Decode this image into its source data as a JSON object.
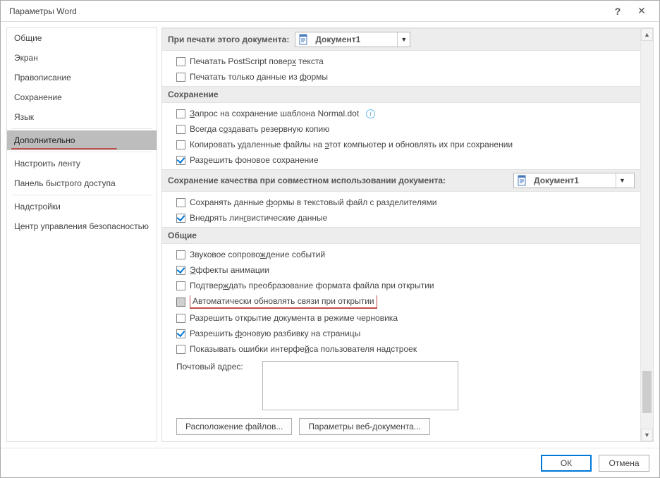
{
  "title": "Параметры Word",
  "titlebar": {
    "help": "?",
    "close": "✕"
  },
  "nav": {
    "items": [
      {
        "label": "Общие"
      },
      {
        "label": "Экран"
      },
      {
        "label": "Правописание"
      },
      {
        "label": "Сохранение"
      },
      {
        "label": "Язык"
      },
      {
        "label": "Дополнительно",
        "selected": true,
        "underline": true
      },
      {
        "label": "Настроить ленту"
      },
      {
        "label": "Панель быстрого доступа"
      },
      {
        "label": "Надстройки"
      },
      {
        "label": "Центр управления безопасностью"
      }
    ]
  },
  "sections": {
    "printDoc": {
      "title": "При печати этого документа:",
      "dropdown": "Документ1",
      "options": [
        {
          "label": "Печатать PostScript поверх текста",
          "checked": false
        },
        {
          "label": "Печатать только данные из формы",
          "checked": false
        }
      ]
    },
    "save": {
      "title": "Сохранение",
      "options": [
        {
          "label": "Запрос на сохранение шаблона Normal.dot",
          "checked": false,
          "info": true
        },
        {
          "label": "Всегда создавать резервную копию",
          "checked": false
        },
        {
          "label": "Копировать удаленные файлы на этот компьютер и обновлять их при сохранении",
          "checked": false
        },
        {
          "label": "Разрешить фоновое сохранение",
          "checked": true
        }
      ]
    },
    "quality": {
      "title": "Сохранение качества при совместном использовании документа:",
      "dropdown": "Документ1",
      "options": [
        {
          "label": "Сохранять данные формы в текстовый файл с разделителями",
          "checked": false
        },
        {
          "label": "Внедрять лингвистические данные",
          "checked": true
        }
      ]
    },
    "general": {
      "title": "Общие",
      "options": [
        {
          "label": "Звуковое сопровождение событий",
          "checked": false
        },
        {
          "label": "Эффекты анимации",
          "checked": true
        },
        {
          "label": "Подтверждать преобразование формата файла при открытии",
          "checked": false
        },
        {
          "label": "Автоматически обновлять связи при открытии",
          "checked": false,
          "highlight": true
        },
        {
          "label": "Разрешить открытие документа в режиме черновика",
          "checked": false
        },
        {
          "label": "Разрешить фоновую разбивку на страницы",
          "checked": true
        },
        {
          "label": "Показывать ошибки интерфейса пользователя надстроек",
          "checked": false
        }
      ],
      "mailLabel": "Почтовый адрес:",
      "btnFiles": "Расположение файлов...",
      "btnWeb": "Параметры веб-документа..."
    }
  },
  "footer": {
    "ok": "ОК",
    "cancel": "Отмена"
  }
}
